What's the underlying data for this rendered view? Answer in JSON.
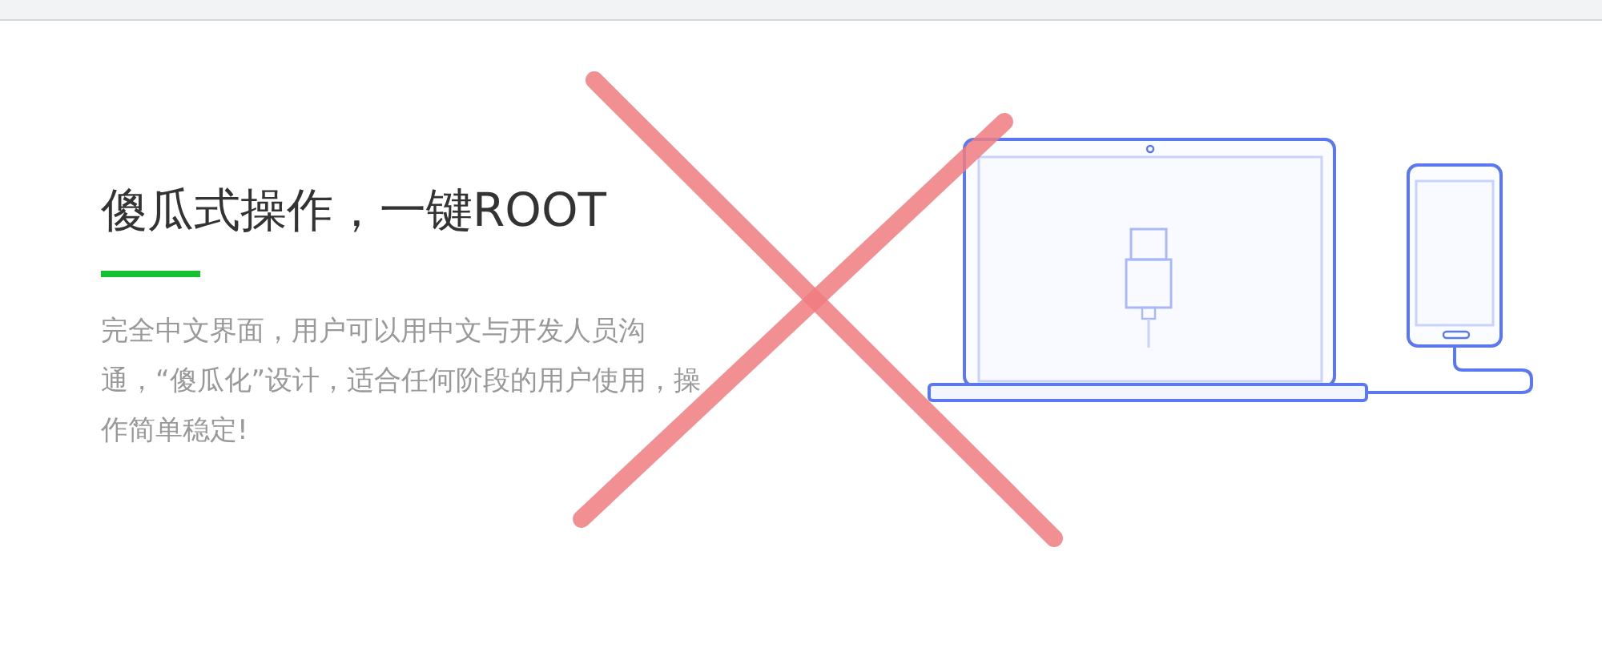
{
  "headline": "傻瓜式操作，一键ROOT",
  "description": "完全中文界面，用户可以用中文与开发人员沟通，“傻瓜化”设计，适合任何阶段的用户使用，操作简单稳定!",
  "overlay_mark": {
    "kind": "cross"
  }
}
